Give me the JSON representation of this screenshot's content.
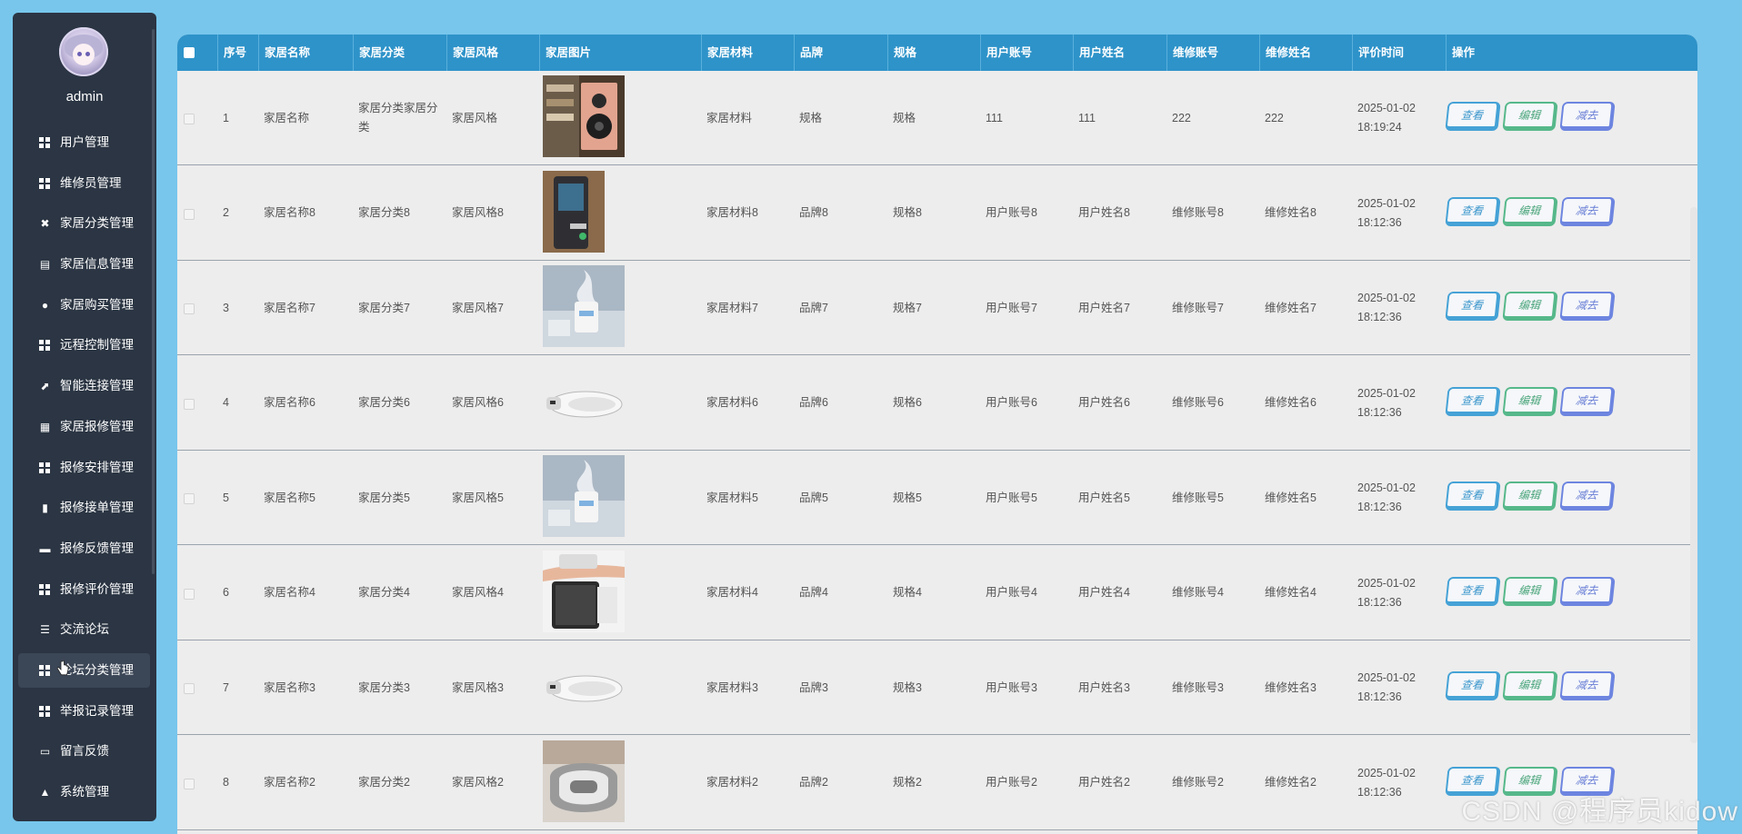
{
  "sidebar": {
    "username": "admin",
    "items": [
      {
        "label": "用户管理",
        "icon": "grid-icon"
      },
      {
        "label": "维修员管理",
        "icon": "grid-icon"
      },
      {
        "label": "家居分类管理",
        "icon": "clipboard-x-icon"
      },
      {
        "label": "家居信息管理",
        "icon": "clipboard-icon"
      },
      {
        "label": "家居购买管理",
        "icon": "user-icon"
      },
      {
        "label": "远程控制管理",
        "icon": "grid-icon"
      },
      {
        "label": "智能连接管理",
        "icon": "line-chart-icon"
      },
      {
        "label": "家居报修管理",
        "icon": "apps-icon"
      },
      {
        "label": "报修安排管理",
        "icon": "grid-icon"
      },
      {
        "label": "报修接单管理",
        "icon": "bar-chart-icon"
      },
      {
        "label": "报修反馈管理",
        "icon": "comment-icon"
      },
      {
        "label": "报修评价管理",
        "icon": "grid-icon"
      },
      {
        "label": "交流论坛",
        "icon": "list-icon"
      },
      {
        "label": "论坛分类管理",
        "icon": "grid-icon",
        "active": true
      },
      {
        "label": "举报记录管理",
        "icon": "grid-icon"
      },
      {
        "label": "留言反馈",
        "icon": "ticket-icon"
      },
      {
        "label": "系统管理",
        "icon": "thumbs-up-icon"
      }
    ]
  },
  "table": {
    "headers": [
      "序号",
      "家居名称",
      "家居分类",
      "家居风格",
      "家居图片",
      "家居材料",
      "品牌",
      "规格",
      "用户账号",
      "用户姓名",
      "维修账号",
      "维修姓名",
      "评价时间",
      "操作"
    ],
    "actions": {
      "view": "查看",
      "edit": "编辑",
      "delete": "减去"
    },
    "rows": [
      {
        "no": "1",
        "name": "家居名称",
        "category": "家居分类家居分类",
        "style": "家居风格",
        "image": "speaker-photo",
        "material": "家居材料",
        "brand": "规格",
        "spec": "规格",
        "user_account": "111",
        "user_name": "111",
        "repair_account": "222",
        "repair_name": "222",
        "time": "2025-01-02 18:19:24"
      },
      {
        "no": "2",
        "name": "家居名称8",
        "category": "家居分类8",
        "style": "家居风格8",
        "image": "smart-lock-photo",
        "material": "家居材料8",
        "brand": "品牌8",
        "spec": "规格8",
        "user_account": "用户账号8",
        "user_name": "用户姓名8",
        "repair_account": "维修账号8",
        "repair_name": "维修姓名8",
        "time": "2025-01-02 18:12:36"
      },
      {
        "no": "3",
        "name": "家居名称7",
        "category": "家居分类7",
        "style": "家居风格7",
        "image": "humidifier-photo",
        "material": "家居材料7",
        "brand": "品牌7",
        "spec": "规格7",
        "user_account": "用户账号7",
        "user_name": "用户姓名7",
        "repair_account": "维修账号7",
        "repair_name": "维修姓名7",
        "time": "2025-01-02 18:12:36"
      },
      {
        "no": "4",
        "name": "家居名称6",
        "category": "家居分类6",
        "style": "家居风格6",
        "image": "toilet-seat-photo",
        "material": "家居材料6",
        "brand": "品牌6",
        "spec": "规格6",
        "user_account": "用户账号6",
        "user_name": "用户姓名6",
        "repair_account": "维修账号6",
        "repair_name": "维修姓名6",
        "time": "2025-01-02 18:12:36"
      },
      {
        "no": "5",
        "name": "家居名称5",
        "category": "家居分类5",
        "style": "家居风格5",
        "image": "humidifier-photo",
        "material": "家居材料5",
        "brand": "品牌5",
        "spec": "规格5",
        "user_account": "用户账号5",
        "user_name": "用户姓名5",
        "repair_account": "维修账号5",
        "repair_name": "维修姓名5",
        "time": "2025-01-02 18:12:36"
      },
      {
        "no": "6",
        "name": "家居名称4",
        "category": "家居分类4",
        "style": "家居风格4",
        "image": "air-purifier-photo",
        "material": "家居材料4",
        "brand": "品牌4",
        "spec": "规格4",
        "user_account": "用户账号4",
        "user_name": "用户姓名4",
        "repair_account": "维修账号4",
        "repair_name": "维修姓名4",
        "time": "2025-01-02 18:12:36"
      },
      {
        "no": "7",
        "name": "家居名称3",
        "category": "家居分类3",
        "style": "家居风格3",
        "image": "toilet-seat-photo",
        "material": "家居材料3",
        "brand": "品牌3",
        "spec": "规格3",
        "user_account": "用户账号3",
        "user_name": "用户姓名3",
        "repair_account": "维修账号3",
        "repair_name": "维修姓名3",
        "time": "2025-01-02 18:12:36"
      },
      {
        "no": "8",
        "name": "家居名称2",
        "category": "家居分类2",
        "style": "家居风格2",
        "image": "massager-photo",
        "material": "家居材料2",
        "brand": "品牌2",
        "spec": "规格2",
        "user_account": "用户账号2",
        "user_name": "用户姓名2",
        "repair_account": "维修账号2",
        "repair_name": "维修姓名2",
        "time": "2025-01-02 18:12:36"
      }
    ]
  },
  "watermark": "CSDN @程序员kidow",
  "colors": {
    "page_bg": "#78c6ec",
    "sidebar_bg": "#2b3543",
    "header_bg": "#2e93c9",
    "view": "#45a2d6",
    "edit": "#56b88a",
    "delete": "#6d85e0"
  }
}
